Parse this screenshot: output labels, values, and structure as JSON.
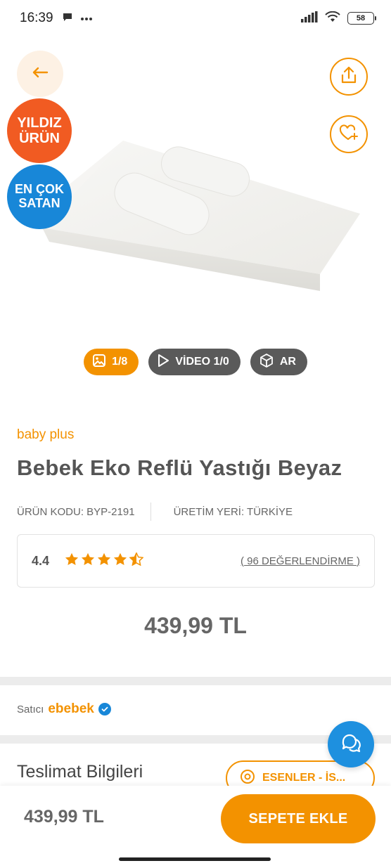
{
  "status_bar": {
    "time": "16:39",
    "battery": "58",
    "icons": [
      "chat-bubble-icon",
      "more-dots-icon",
      "signal-icon",
      "wifi-icon",
      "battery-icon"
    ]
  },
  "hero": {
    "badge_star_line1": "YILDIZ",
    "badge_star_line2": "ÜRÜN",
    "badge_best_line1": "EN ÇOK",
    "badge_best_line2": "SATAN",
    "colors": {
      "accent": "#f39200",
      "star_badge": "#f15b22",
      "best_badge": "#1887d8",
      "pill_dark": "#5a5a5a"
    }
  },
  "media": {
    "photo_label": "1/8",
    "video_label": "VİDEO 1/0",
    "ar_label": "AR"
  },
  "product": {
    "brand": "baby plus",
    "title": "Bebek Eko Reflü Yastığı Beyaz",
    "code": "ÜRÜN KODU: BYP-2191",
    "origin": "ÜRETİM YERİ: TÜRKİYE",
    "rating": "4.4",
    "rating_value": 4.4,
    "rating_max": 5,
    "reviews": "( 96 DEĞERLENDİRME )",
    "price": "439,99 TL"
  },
  "seller": {
    "label": "Satıcı",
    "name": "ebebek"
  },
  "delivery": {
    "title": "Teslimat Bilgileri",
    "location": "ESENLER - İS..."
  },
  "bottom_bar": {
    "price": "439,99 TL",
    "add_to_cart": "SEPETE EKLE"
  }
}
